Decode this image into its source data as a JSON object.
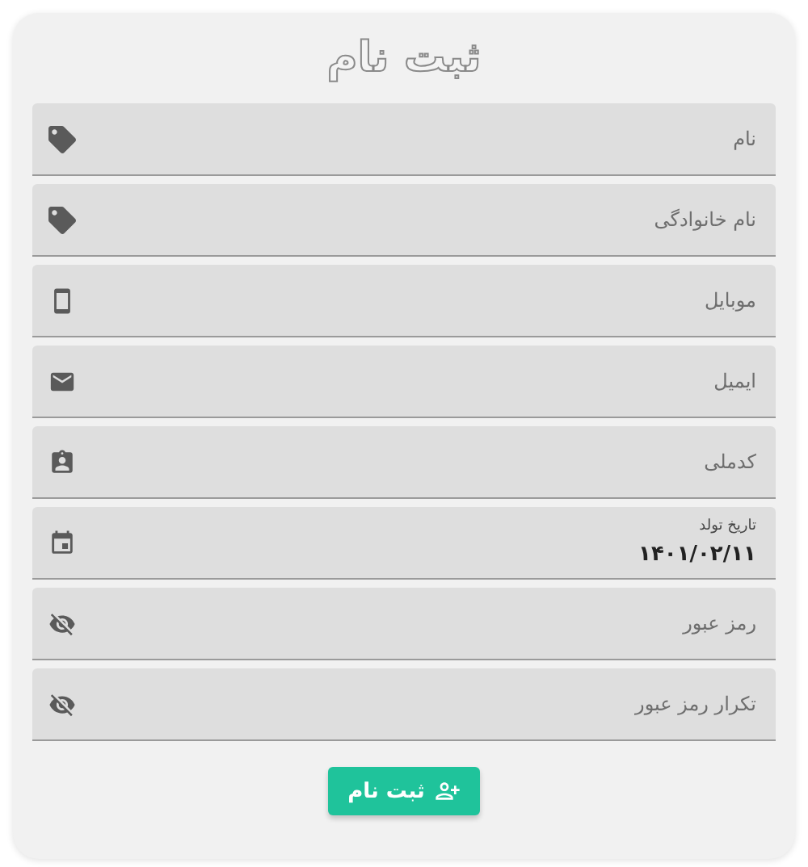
{
  "title": "ثبت نام",
  "fields": [
    {
      "kind": "text",
      "placeholder": "نام"
    },
    {
      "kind": "text",
      "placeholder": "نام خانوادگی"
    },
    {
      "kind": "tel",
      "placeholder": "موبایل"
    },
    {
      "kind": "email",
      "placeholder": "ایمیل"
    },
    {
      "kind": "national-id",
      "placeholder": "کدملی"
    },
    {
      "kind": "date",
      "label": "تاریخ تولد",
      "value": "۱۴۰۱/۰۲/۱۱"
    },
    {
      "kind": "password",
      "placeholder": "رمز عبور"
    },
    {
      "kind": "password",
      "placeholder": "تکرار رمز عبور"
    }
  ],
  "submit": {
    "label": "ثبت نام"
  }
}
